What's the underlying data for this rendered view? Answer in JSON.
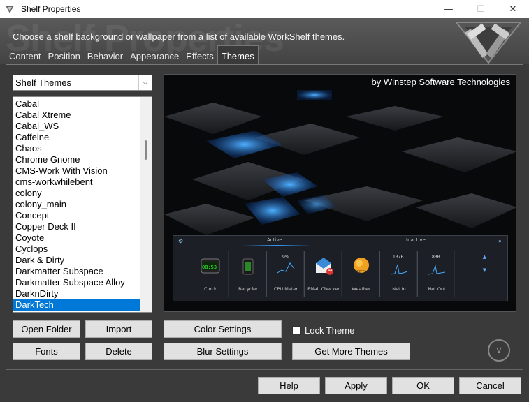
{
  "window": {
    "title": "Shelf Properties",
    "controls": [
      "minimize",
      "maximize",
      "close"
    ]
  },
  "banner": {
    "ghost_text": "Shelf Properties",
    "description": "Choose a shelf background or wallpaper from a list of available WorkShelf themes."
  },
  "tabs": [
    {
      "label": "Content",
      "active": false
    },
    {
      "label": "Position",
      "active": false
    },
    {
      "label": "Behavior",
      "active": false
    },
    {
      "label": "Appearance",
      "active": false
    },
    {
      "label": "Effects",
      "active": false
    },
    {
      "label": "Themes",
      "active": true
    }
  ],
  "theme_category": {
    "selected": "Shelf Themes"
  },
  "theme_list": {
    "items": [
      "Cabal",
      "Cabal Xtreme",
      "Cabal_WS",
      "Caffeine",
      "Chaos",
      "Chrome Gnome",
      "CMS-Work With Vision",
      "cms-workwhilebent",
      "colony",
      "colony_main",
      "Concept",
      "Copper Deck II",
      "Coyote",
      "Cyclops",
      "Dark & Dirty",
      "Darkmatter Subspace",
      "Darkmatter Subspace Alloy",
      "DarknDirty",
      "DarkTech"
    ],
    "selected": "DarkTech"
  },
  "preview": {
    "credit": "by Winstep Software Technologies",
    "shelf_tabs": [
      "Active",
      "Inactive"
    ],
    "shelf_items": [
      {
        "label": "Clock",
        "value": "08:53"
      },
      {
        "label": "Recycler"
      },
      {
        "label": "CPU Meter",
        "value": "9%"
      },
      {
        "label": "EMail Checker",
        "value": "44"
      },
      {
        "label": "Weather",
        "value": "32°C"
      },
      {
        "label": "Net In",
        "value": "137B"
      },
      {
        "label": "Net Out",
        "value": "83B"
      }
    ]
  },
  "actions": {
    "open_folder": "Open Folder",
    "import": "Import",
    "fonts": "Fonts",
    "delete": "Delete",
    "color_settings": "Color Settings",
    "blur_settings": "Blur Settings",
    "lock_theme": "Lock Theme",
    "lock_theme_checked": false,
    "get_more_themes": "Get More Themes"
  },
  "footer": {
    "help": "Help",
    "apply": "Apply",
    "ok": "OK",
    "cancel": "Cancel"
  },
  "colors": {
    "accent": "#0078d7",
    "background": "#3a3a3a",
    "preview_glow": "#1e90ff"
  }
}
